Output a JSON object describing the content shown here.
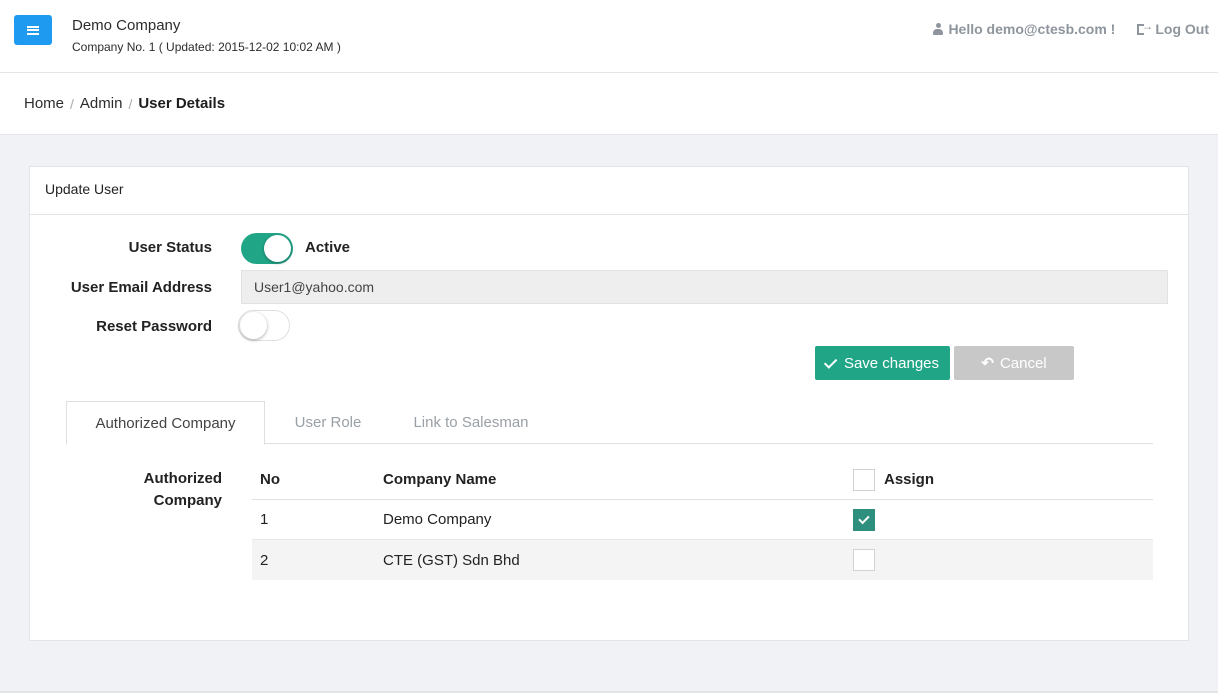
{
  "header": {
    "company_name": "Demo Company",
    "company_sub": "Company No. 1 ( Updated: 2015-12-02 10:02 AM )",
    "greeting": "Hello demo@ctesb.com !",
    "logout": "Log Out"
  },
  "breadcrumb": {
    "home": "Home",
    "admin": "Admin",
    "current": "User Details",
    "separator": "/"
  },
  "card": {
    "title": "Update User",
    "user_status_label": "User Status",
    "user_status_on": true,
    "user_status_text": "Active",
    "email_label": "User Email Address",
    "email_value": "User1@yahoo.com",
    "reset_password_label": "Reset Password",
    "reset_password_on": false,
    "save_label": "Save changes",
    "cancel_label": "Cancel"
  },
  "tabs": [
    {
      "label": "Authorized Company",
      "active": true
    },
    {
      "label": "User Role",
      "active": false
    },
    {
      "label": "Link to Salesman",
      "active": false
    }
  ],
  "company_table": {
    "section_label": "Authorized Company",
    "columns": {
      "no": "No",
      "name": "Company Name",
      "assign": "Assign"
    },
    "rows": [
      {
        "no": "1",
        "name": "Demo Company",
        "assigned": true
      },
      {
        "no": "2",
        "name": "CTE (GST) Sdn Bhd",
        "assigned": false
      }
    ]
  },
  "colors": {
    "accent": "#20a687",
    "menu_button": "#1e9bf0",
    "cancel_button": "#c8c8c8"
  }
}
